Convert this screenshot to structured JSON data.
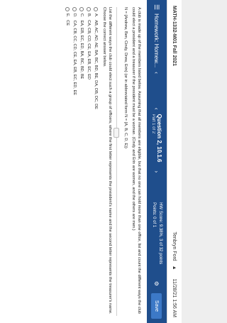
{
  "topbar": {
    "course": "MATH-1332-M01 Fall 2021",
    "user": "Tenbryn Ford",
    "date": "11/28/21 1:56 AM"
  },
  "hwbar": {
    "title": "Homework: Homew...",
    "question_title": "Question 2, 10.1.6",
    "question_part": "Part 1 of 2",
    "hw_score": "HW Score: 9.38%, 3 of 32 points",
    "points": "Points: 0 of 1",
    "save_label": "Save"
  },
  "question": {
    "intro": "A club is made up of the members listed below. Assuming that all members are eligible, but that no one can hold more than one office, list and count the different ways the club could elect a president and a treasurer if the president must be a woman. (Cindy and Erin are women, and the others are men.)",
    "members": "N = {Andrew, Ben, Cindy, Drew, Erin} (or in abbreviated form N = {A, B, C, D, E})",
    "prompt": "List the different ways the club could elect such a group of officers, where the first letter represents the president's name and the second letter represents the treasurer's name. Choose the correct answer below."
  },
  "options": [
    {
      "letter": "A.",
      "text": "AB, AC, AD, AE, BA, BC, BD, BE, DA, DB, DC, DE"
    },
    {
      "letter": "B.",
      "text": "CA, CB, CD, CE, EA, EB, EC, ED"
    },
    {
      "letter": "C.",
      "text": "EA, EB, EC, ED, BA, BC, BD, BE"
    },
    {
      "letter": "D.",
      "text": "CA, CB, CC, CD, CE, EA, EB, EC, ED, EE"
    },
    {
      "letter": "E.",
      "text": "CE"
    }
  ]
}
